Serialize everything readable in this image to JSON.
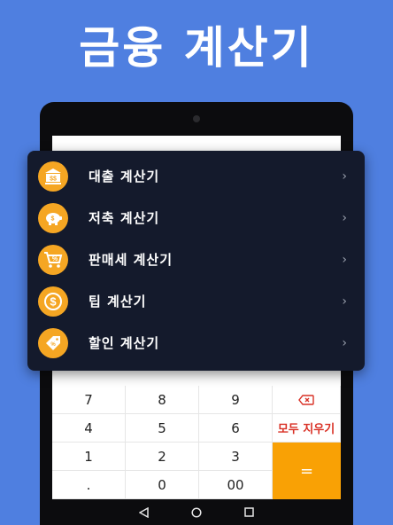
{
  "headline": "금융 계산기",
  "menu": {
    "items": [
      {
        "label": "대출 계산기",
        "icon": "bank-icon"
      },
      {
        "label": "저축 계산기",
        "icon": "piggy-bank-icon"
      },
      {
        "label": "판매세 계산기",
        "icon": "shopping-cart-percent-icon"
      },
      {
        "label": "팁 계산기",
        "icon": "dollar-coin-icon"
      },
      {
        "label": "할인 계산기",
        "icon": "discount-tag-icon"
      }
    ],
    "chevron": "›"
  },
  "keypad": {
    "row1": [
      "7",
      "8",
      "9"
    ],
    "row2": [
      "4",
      "5",
      "6"
    ],
    "row3": [
      "1",
      "2",
      "3"
    ],
    "row4": [
      ".",
      "0",
      "00"
    ],
    "clear_all": "모두 지우기",
    "equals": "=",
    "backspace_icon": "backspace-icon"
  },
  "navbar": {
    "back_icon": "back-triangle-icon",
    "home_icon": "home-circle-icon",
    "recents_icon": "recents-square-icon"
  },
  "colors": {
    "background": "#4f7fe0",
    "menu_background": "#141a2c",
    "accent": "#f5a623",
    "equals_key": "#f9a105",
    "clear_text": "#d93025"
  }
}
